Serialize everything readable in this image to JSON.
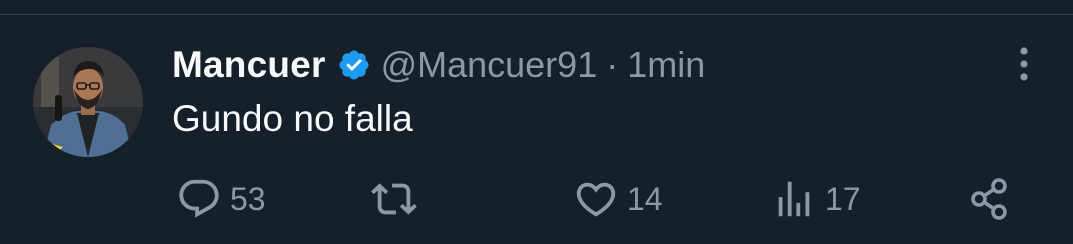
{
  "tweet": {
    "display_name": "Mancuer",
    "handle": "@Mancuer91",
    "separator": "·",
    "time": "1min",
    "text": "Gundo no falla",
    "verified": true
  },
  "actions": {
    "replies": "53",
    "retweets": "",
    "likes": "14",
    "views": "17"
  },
  "icons": {
    "reply": "reply-icon",
    "retweet": "retweet-icon",
    "like": "heart-icon",
    "views": "views-icon",
    "share": "share-icon",
    "more": "more-options-icon",
    "verified": "verified-badge-icon"
  },
  "colors": {
    "background": "#15202b",
    "text": "#f7f9f9",
    "secondary": "#8b98a5",
    "verified": "#1d9bf0",
    "divider": "#38444d"
  }
}
